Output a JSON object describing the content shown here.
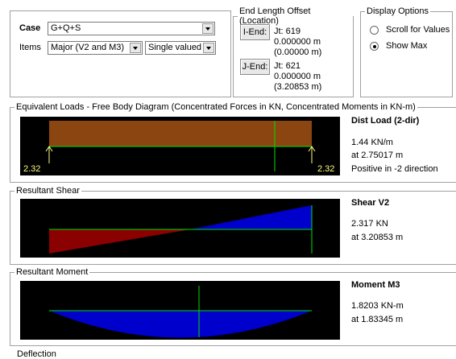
{
  "case_group": {
    "case_label": "Case",
    "case_value": "G+Q+S",
    "items_label": "Items",
    "items_value": "Major (V2 and M3)",
    "valued_value": "Single valued"
  },
  "end_offset": {
    "legend": "End Length Offset (Location)",
    "i_end": {
      "button": "I-End:",
      "jt": "Jt:  619",
      "offset": "0.000000 m",
      "location": "(0.00000 m)"
    },
    "j_end": {
      "button": "J-End:",
      "jt": "Jt:  621",
      "offset": "0.000000 m",
      "location": "(3.20853 m)"
    }
  },
  "display_options": {
    "legend": "Display Options",
    "options": [
      {
        "label": "Scroll for Values",
        "selected": false
      },
      {
        "label": "Show Max",
        "selected": true
      }
    ]
  },
  "equiv_loads": {
    "legend": "Equivalent Loads - Free Body Diagram  (Concentrated Forces in KN, Concentrated Moments in KN-m)",
    "left_reaction": "2.32",
    "right_reaction": "2.32",
    "title": "Dist Load (2-dir)",
    "value": "1.44 KN/m",
    "location": "at 2.75017 m",
    "direction": "Positive in -2 direction",
    "colors": {
      "load_fill": "#8b4511",
      "reaction": "#ffff80",
      "marker": "#00e000"
    }
  },
  "shear": {
    "legend": "Resultant Shear",
    "title": "Shear V2",
    "value": "2.317 KN",
    "location": "at 3.20853 m",
    "values_kn": {
      "start": -2.32,
      "end": 2.317
    },
    "colors": {
      "negative": "#8b0000",
      "positive": "#0000cd",
      "axis": "#00e000"
    }
  },
  "moment": {
    "legend": "Resultant Moment",
    "title": "Moment M3",
    "value": "1.8203 KN-m",
    "location": "at 1.83345 m",
    "colors": {
      "fill": "#0000cd",
      "axis": "#00e000"
    }
  },
  "deflection": {
    "legend": "Deflection"
  }
}
